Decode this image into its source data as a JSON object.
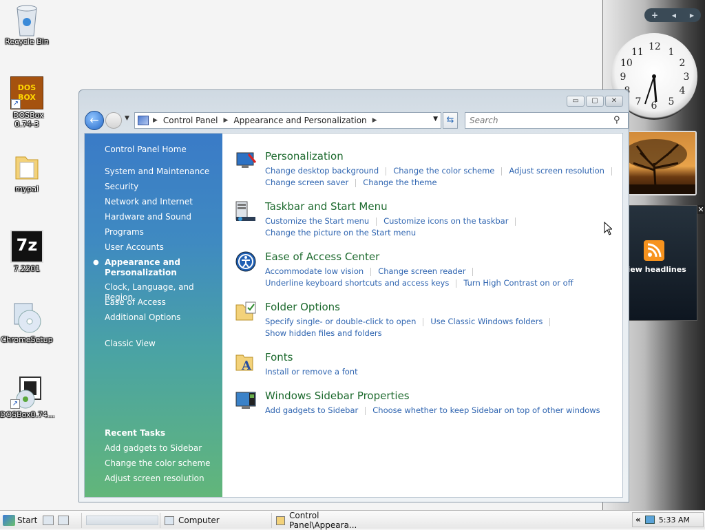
{
  "desktop": {
    "icons": [
      {
        "label": "Recycle Bin"
      },
      {
        "label": "DOSBox 0.74-3"
      },
      {
        "label": "mypal"
      },
      {
        "label": "7.2201"
      },
      {
        "label": "ChromeSetup"
      },
      {
        "label": "DOSBox0.74..."
      }
    ],
    "dosbox_logo": "DOS BOX",
    "sevenzip_logo": "7z"
  },
  "sidebar": {
    "controls": [
      "+",
      "◀",
      "▶"
    ],
    "clock_numbers": [
      "12",
      "1",
      "2",
      "3",
      "4",
      "5",
      "6",
      "7",
      "8",
      "9",
      "10",
      "11"
    ],
    "clock_time": "5:33",
    "feeds_label": "View headlines",
    "feeds_close": "✕"
  },
  "window": {
    "buttons": {
      "minimize": "▭",
      "maximize": "▢",
      "close": "✕"
    },
    "address": {
      "crumbs": [
        "Control Panel",
        "Appearance and Personalization"
      ]
    },
    "search_placeholder": "Search",
    "left_pane": {
      "home": "Control Panel Home",
      "items": [
        "System and Maintenance",
        "Security",
        "Network and Internet",
        "Hardware and Sound",
        "Programs",
        "User Accounts",
        "Appearance and Personalization",
        "Clock, Language, and Region",
        "Ease of Access",
        "Additional Options"
      ],
      "classic_view": "Classic View",
      "recent_tasks_header": "Recent Tasks",
      "recent_tasks": [
        "Add gadgets to Sidebar",
        "Change the color scheme",
        "Adjust screen resolution"
      ]
    },
    "categories": [
      {
        "title": "Personalization",
        "rows": [
          [
            "Change desktop background",
            "Change the color scheme",
            "Adjust screen resolution"
          ],
          [
            "Change screen saver",
            "Change the theme"
          ]
        ]
      },
      {
        "title": "Taskbar and Start Menu",
        "rows": [
          [
            "Customize the Start menu",
            "Customize icons on the taskbar"
          ],
          [
            "Change the picture on the Start menu"
          ]
        ]
      },
      {
        "title": "Ease of Access Center",
        "rows": [
          [
            "Accommodate low vision",
            "Change screen reader"
          ],
          [
            "Underline keyboard shortcuts and access keys",
            "Turn High Contrast on or off"
          ]
        ]
      },
      {
        "title": "Folder Options",
        "rows": [
          [
            "Specify single- or double-click to open",
            "Use Classic Windows folders"
          ],
          [
            "Show hidden files and folders"
          ]
        ]
      },
      {
        "title": "Fonts",
        "rows": [
          [
            "Install or remove a font"
          ]
        ]
      },
      {
        "title": "Windows Sidebar Properties",
        "rows": [
          [
            "Add gadgets to Sidebar",
            "Choose whether to keep Sidebar on top of other windows"
          ]
        ]
      }
    ]
  },
  "taskbar": {
    "start_label": "Start",
    "tasks": [
      "Computer",
      "Control Panel\\Appeara..."
    ],
    "tray_chevron": "«",
    "time": "5:33 AM"
  }
}
